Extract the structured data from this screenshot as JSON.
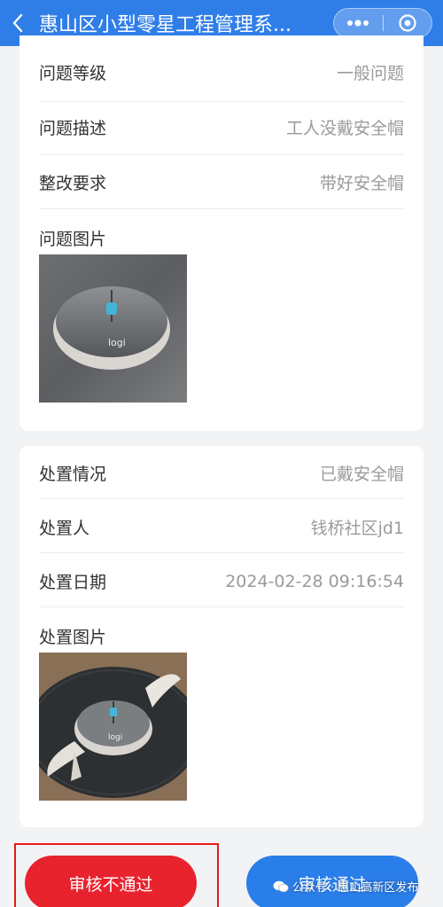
{
  "header": {
    "title": "惠山区小型零星工程管理系..."
  },
  "issue": {
    "level": {
      "label": "问题等级",
      "value": "一般问题"
    },
    "description": {
      "label": "问题描述",
      "value": "工人没戴安全帽"
    },
    "requirement": {
      "label": "整改要求",
      "value": "带好安全帽"
    },
    "photo_label": "问题图片"
  },
  "handling": {
    "status": {
      "label": "处置情况",
      "value": "已戴安全帽"
    },
    "handler": {
      "label": "处置人",
      "value": "钱桥社区jd1"
    },
    "date": {
      "label": "处置日期",
      "value": "2024-02-28 09:16:54"
    },
    "photo_label": "处置图片"
  },
  "mouse_brand": "logi",
  "actions": {
    "reject_label": "审核不通过",
    "approve_label": "审核通过"
  },
  "watermark": {
    "text": "公众号 · 惠山高新区发布"
  },
  "colors": {
    "header": "#2f7ee8",
    "reject": "#e8232e",
    "approve": "#2a7ee9",
    "highlight": "#e81818"
  }
}
